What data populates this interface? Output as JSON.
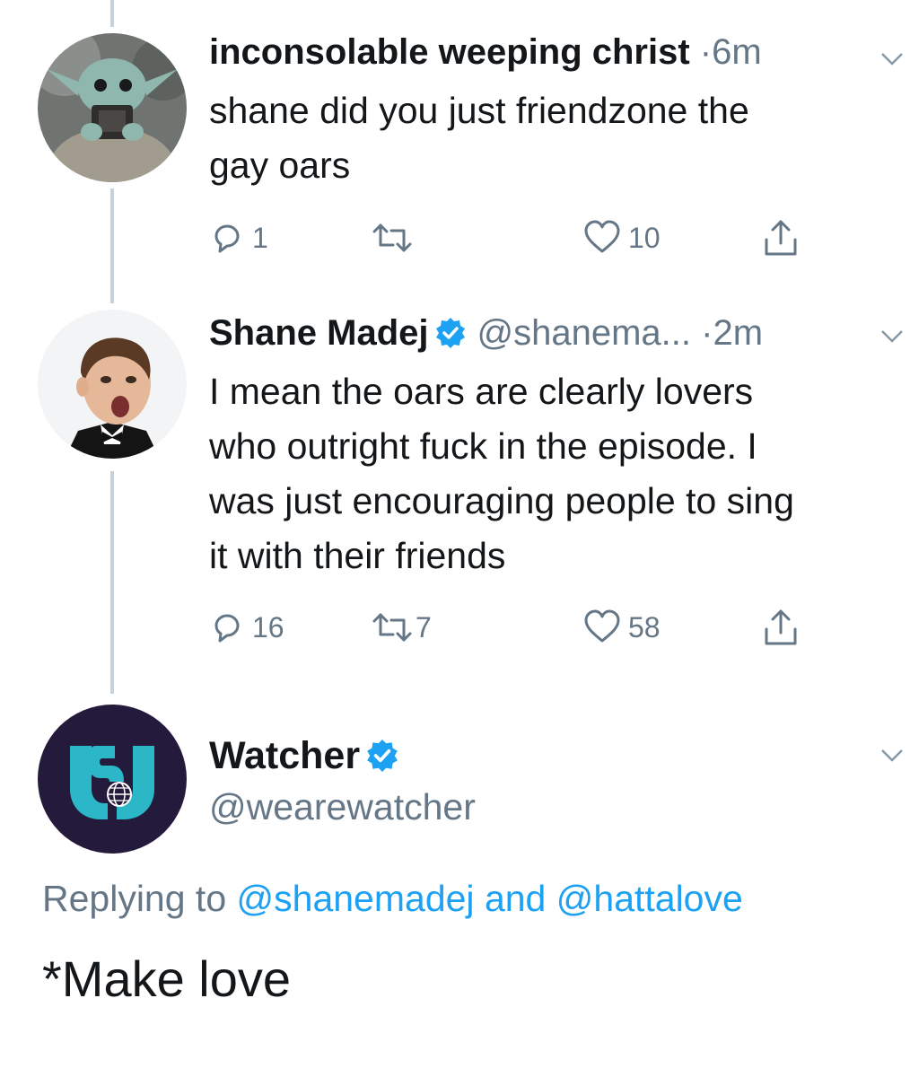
{
  "tweets": [
    {
      "display_name": "inconsolable weeping christ",
      "separator": "·",
      "time": "6m",
      "text_lines": [
        "shane did you just friendzone the",
        "gay oars"
      ],
      "replies": "1",
      "retweets": "",
      "likes": "10",
      "icons": {
        "avatar": "baby-yoda-avatar",
        "caret": "chevron-down-icon"
      }
    },
    {
      "display_name": "Shane Madej",
      "handle": "@shanema...",
      "separator": "·",
      "time": "2m",
      "verified": true,
      "text_lines": [
        "I mean the oars are clearly lovers",
        "who outright fuck in the episode. I",
        "was just encouraging people to sing",
        "it with their friends"
      ],
      "replies": "16",
      "retweets": "7",
      "likes": "58",
      "icons": {
        "avatar": "shane-madej-avatar",
        "caret": "chevron-down-icon"
      }
    }
  ],
  "focused_tweet": {
    "display_name": "Watcher",
    "handle": "@wearewatcher",
    "verified": true,
    "replying_prefix": "Replying to",
    "replying_user1": "@shanemadej",
    "replying_and": "and",
    "replying_user2": "@hattalove",
    "text": "*Make love",
    "icons": {
      "avatar": "watcher-logo-avatar",
      "caret": "chevron-down-icon"
    }
  },
  "colors": {
    "text": "#14171a",
    "secondary": "#657786",
    "link": "#1da1f2",
    "verified": "#1da1f2",
    "thread_line": "#c9d2d9",
    "watcher_bg": "#241a3b",
    "watcher_logo": "#2bb7c7"
  }
}
